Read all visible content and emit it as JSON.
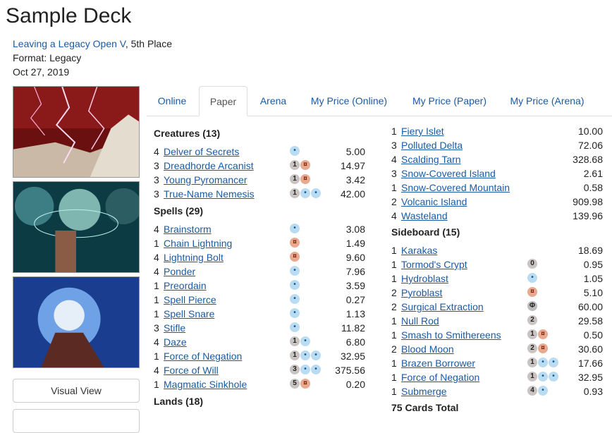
{
  "page": {
    "title": "Sample Deck",
    "event_link": "Leaving a Legacy Open V",
    "event_place": ", 5th Place",
    "format": "Format: Legacy",
    "date": "Oct 27, 2019"
  },
  "buttons": {
    "visual_view": "Visual View"
  },
  "tabs": [
    "Online",
    "Paper",
    "Arena",
    "My Price (Online)",
    "My Price (Paper)",
    "My Price (Arena)"
  ],
  "active_tab": "Paper",
  "mana_colors": {
    "U": "#b9dcf3",
    "R": "#e9a98f",
    "generic": "#c9c4c1"
  },
  "sections": {
    "creatures": {
      "title": "Creatures (13)",
      "cards": [
        {
          "q": "4",
          "name": "Delver of Secrets",
          "mana": [
            "U"
          ],
          "price": "5.00"
        },
        {
          "q": "3",
          "name": "Dreadhorde Arcanist",
          "mana": [
            "1",
            "R"
          ],
          "price": "14.97"
        },
        {
          "q": "3",
          "name": "Young Pyromancer",
          "mana": [
            "1",
            "R"
          ],
          "price": "3.42"
        },
        {
          "q": "3",
          "name": "True-Name Nemesis",
          "mana": [
            "1",
            "U",
            "U"
          ],
          "price": "42.00"
        }
      ]
    },
    "spells": {
      "title": "Spells (29)",
      "cards": [
        {
          "q": "4",
          "name": "Brainstorm",
          "mana": [
            "U"
          ],
          "price": "3.08"
        },
        {
          "q": "1",
          "name": "Chain Lightning",
          "mana": [
            "R"
          ],
          "price": "1.49"
        },
        {
          "q": "4",
          "name": "Lightning Bolt",
          "mana": [
            "R"
          ],
          "price": "9.60"
        },
        {
          "q": "4",
          "name": "Ponder",
          "mana": [
            "U"
          ],
          "price": "7.96"
        },
        {
          "q": "1",
          "name": "Preordain",
          "mana": [
            "U"
          ],
          "price": "3.59"
        },
        {
          "q": "1",
          "name": "Spell Pierce",
          "mana": [
            "U"
          ],
          "price": "0.27"
        },
        {
          "q": "1",
          "name": "Spell Snare",
          "mana": [
            "U"
          ],
          "price": "1.13"
        },
        {
          "q": "3",
          "name": "Stifle",
          "mana": [
            "U"
          ],
          "price": "11.82"
        },
        {
          "q": "4",
          "name": "Daze",
          "mana": [
            "1",
            "U"
          ],
          "price": "6.80"
        },
        {
          "q": "1",
          "name": "Force of Negation",
          "mana": [
            "1",
            "U",
            "U"
          ],
          "price": "32.95"
        },
        {
          "q": "4",
          "name": "Force of Will",
          "mana": [
            "3",
            "U",
            "U"
          ],
          "price": "375.56"
        },
        {
          "q": "1",
          "name": "Magmatic Sinkhole",
          "mana": [
            "5",
            "R"
          ],
          "price": "0.20"
        }
      ]
    },
    "lands": {
      "title": "Lands (18)",
      "cards": [
        {
          "q": "1",
          "name": "Fiery Islet",
          "price": "10.00"
        },
        {
          "q": "3",
          "name": "Polluted Delta",
          "price": "72.06"
        },
        {
          "q": "4",
          "name": "Scalding Tarn",
          "price": "328.68"
        },
        {
          "q": "3",
          "name": "Snow-Covered Island",
          "price": "2.61"
        },
        {
          "q": "1",
          "name": "Snow-Covered Mountain",
          "price": "0.58"
        },
        {
          "q": "2",
          "name": "Volcanic Island",
          "price": "909.98"
        },
        {
          "q": "4",
          "name": "Wasteland",
          "price": "139.96"
        }
      ]
    },
    "sideboard": {
      "title": "Sideboard (15)",
      "cards": [
        {
          "q": "1",
          "name": "Karakas",
          "mana": [],
          "price": "18.69"
        },
        {
          "q": "1",
          "name": "Tormod's Crypt",
          "mana": [
            "0"
          ],
          "price": "0.95"
        },
        {
          "q": "1",
          "name": "Hydroblast",
          "mana": [
            "U"
          ],
          "price": "1.05"
        },
        {
          "q": "2",
          "name": "Pyroblast",
          "mana": [
            "R"
          ],
          "price": "5.10"
        },
        {
          "q": "2",
          "name": "Surgical Extraction",
          "mana": [
            "P"
          ],
          "price": "60.00"
        },
        {
          "q": "1",
          "name": "Null Rod",
          "mana": [
            "2"
          ],
          "price": "29.58"
        },
        {
          "q": "1",
          "name": "Smash to Smithereens",
          "mana": [
            "1",
            "R"
          ],
          "price": "0.50"
        },
        {
          "q": "2",
          "name": "Blood Moon",
          "mana": [
            "2",
            "R"
          ],
          "price": "30.60"
        },
        {
          "q": "1",
          "name": "Brazen Borrower",
          "mana": [
            "1",
            "U",
            "U"
          ],
          "price": "17.66"
        },
        {
          "q": "1",
          "name": "Force of Negation",
          "mana": [
            "1",
            "U",
            "U"
          ],
          "price": "32.95"
        },
        {
          "q": "1",
          "name": "Submerge",
          "mana": [
            "4",
            "U"
          ],
          "price": "0.93"
        }
      ]
    }
  },
  "total": "75 Cards Total"
}
